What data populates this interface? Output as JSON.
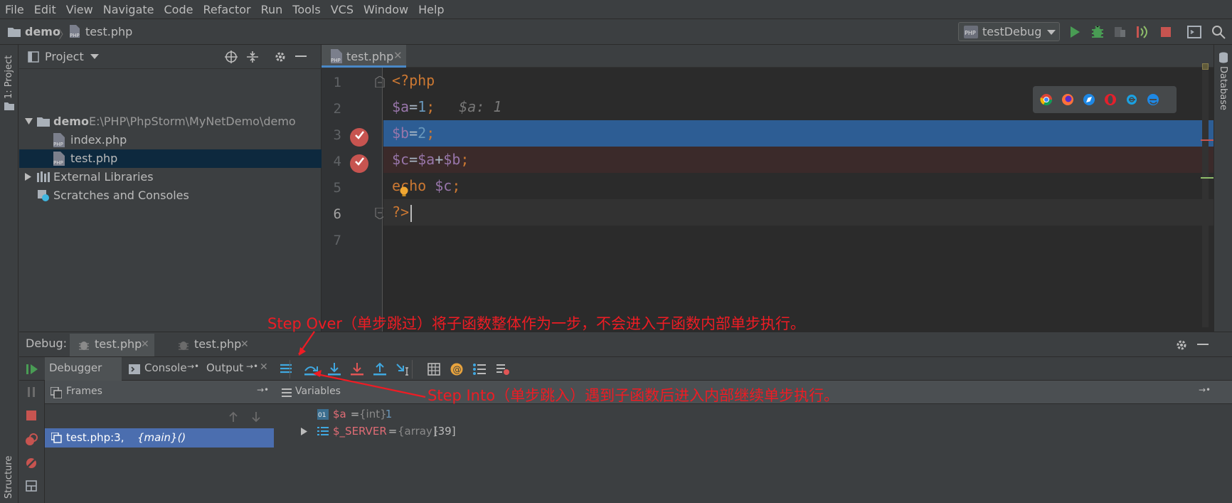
{
  "menu": [
    "File",
    "Edit",
    "View",
    "Navigate",
    "Code",
    "Refactor",
    "Run",
    "Tools",
    "VCS",
    "Window",
    "Help"
  ],
  "breadcrumb": {
    "project": "demo",
    "file": "test.php"
  },
  "run_config": "testDebug",
  "stripes": {
    "left_top": "1: Project",
    "left_bottom": "Structure",
    "right": "Database"
  },
  "project": {
    "title": "Project",
    "root_name": "demo",
    "root_path": "E:\\PHP\\PhpStorm\\MyNetDemo\\demo",
    "files": [
      "index.php",
      "test.php"
    ],
    "external": "External Libraries",
    "scratches": "Scratches and Consoles"
  },
  "editor": {
    "tab": "test.php",
    "line_numbers": [
      "1",
      "2",
      "3",
      "4",
      "5",
      "6",
      "7"
    ],
    "code": {
      "l1": "<?php",
      "l2_var": "$a",
      "l2_eq": "=",
      "l2_num": "1",
      "l2_semi": ";",
      "l2_hint": "$a: 1",
      "l3_var": "$b",
      "l3_eq": "=",
      "l3_num": "2",
      "l3_semi": ";",
      "l4_a": "$c",
      "l4_b": "=",
      "l4_c": "$a",
      "l4_d": "+",
      "l4_e": "$b",
      "l4_f": ";",
      "l5_kw": "echo",
      "l5_var": "$c",
      "l5_semi": ";",
      "l6": "?>"
    }
  },
  "debug": {
    "label": "Debug:",
    "tabs": [
      "test.php",
      "test.php"
    ],
    "subtabs": [
      "Debugger",
      "Console",
      "Output"
    ],
    "frames_title": "Frames",
    "frame_item": "test.php:3,",
    "frame_main": "{main}()",
    "variables_title": "Variables",
    "vars": [
      {
        "name": "$a",
        "eq": " = ",
        "type": "{int}",
        "value": " 1"
      },
      {
        "name": "$_SERVER",
        "eq": " = ",
        "type": "{array}",
        "value": " [39]"
      }
    ]
  },
  "annotations": {
    "step_over": "Step Over（单步跳过）将子函数整体作为一步，不会进入子函数内部单步执行。",
    "step_into": "Step Into（单步跳入）遇到子函数后进入内部继续单步执行。"
  },
  "colors": {
    "accent": "#4a88c7",
    "selection": "#2d5d94",
    "error_line": "#3b2a2a",
    "annotation": "#ee1c24",
    "breakpoint": "#c75450"
  }
}
